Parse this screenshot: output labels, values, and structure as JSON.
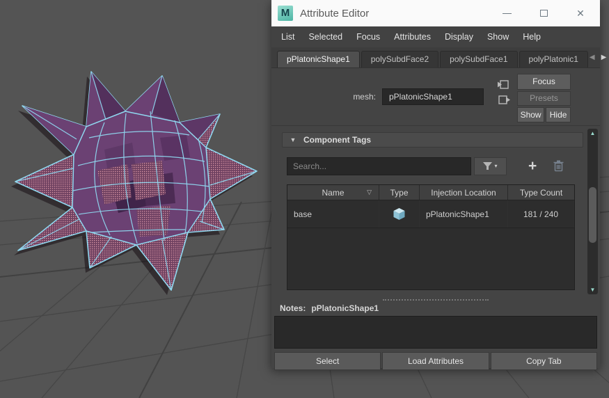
{
  "window": {
    "title": "Attribute Editor",
    "icon_letter": "M"
  },
  "menu": {
    "items": [
      "List",
      "Selected",
      "Focus",
      "Attributes",
      "Display",
      "Show",
      "Help"
    ]
  },
  "tabs": {
    "items": [
      {
        "label": "pPlatonicShape1",
        "active": true
      },
      {
        "label": "polySubdFace2",
        "active": false
      },
      {
        "label": "polySubdFace1",
        "active": false
      },
      {
        "label": "polyPlatonic1",
        "active": false
      }
    ]
  },
  "header": {
    "field_label": "mesh:",
    "field_value": "pPlatonicShape1",
    "focus_label": "Focus",
    "presets_label": "Presets",
    "show_label": "Show",
    "hide_label": "Hide"
  },
  "component_tags": {
    "title": "Component Tags",
    "search_placeholder": "Search...",
    "columns": [
      "Name",
      "Type",
      "Injection Location",
      "Type Count"
    ],
    "rows": [
      {
        "name": "base",
        "type_icon": "cube-icon",
        "injection_location": "pPlatonicShape1",
        "type_count": "181 / 240"
      }
    ]
  },
  "notes": {
    "label": "Notes:",
    "value": "pPlatonicShape1"
  },
  "footer": {
    "buttons": [
      "Select",
      "Load Attributes",
      "Copy Tab"
    ]
  },
  "icons": {
    "close": "✕",
    "tab_scroll_left": "◀",
    "tab_scroll_right": "▶",
    "section_collapse": "▼",
    "sort": "▽",
    "filter_caret": "▾",
    "plus": "+",
    "scroll_up": "▲",
    "scroll_down": "▼"
  },
  "colors": {
    "viewport_bg": "#545454",
    "grid_line": "#464646",
    "panel_bg": "#444444",
    "field_bg": "#282828",
    "wireframe_cyan": "#8fd8f0",
    "face_purple": "#6b4173",
    "face_dark_purple": "#4c2b54",
    "stipple_pink": "#dd9aa8",
    "scroll_accent_teal": "#9adbce",
    "maya_teal": "#4db4a4"
  }
}
